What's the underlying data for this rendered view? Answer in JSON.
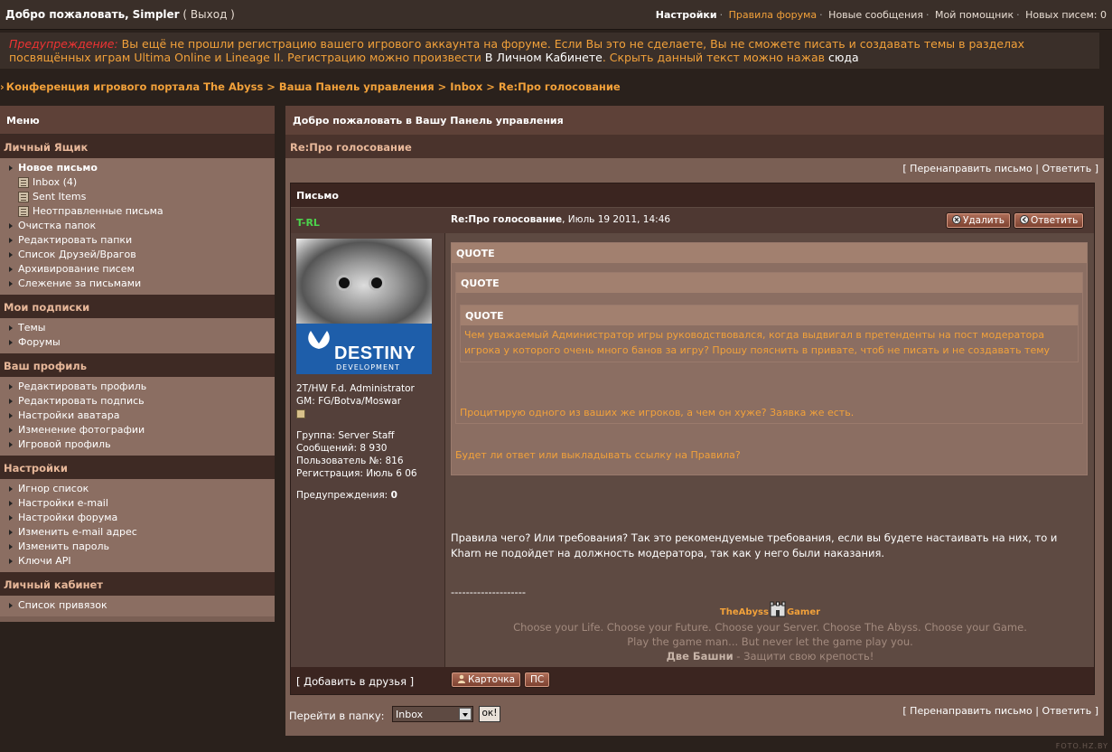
{
  "topbar": {
    "welcome": "Добро пожаловать,",
    "username": "Simpler",
    "logout": "( Выход )",
    "settings": "Настройки",
    "rules": "Правила форума",
    "new_messages": "Новые сообщения",
    "assistant": "Мой помощник",
    "new_letters": "Новых писем: 0"
  },
  "warning": {
    "label": "Предупреждение:",
    "text1": "Вы ещё не прошли регистрацию вашего игрового аккаунта на форуме. Если Вы это не сделаете, Вы не сможете писать и создавать темы в разделах посвящённых играм Ultima Online и Lineage II. Регистрацию можно произвести",
    "cabinet_link": "В Личном Кабинете",
    "text2": ". Скрыть данный текст можно нажав",
    "here_link": "сюда"
  },
  "breadcrumb": "Конференция игрового портала The Abyss > Ваша Панель управления > Inbox > Re:Про голосование",
  "sidebar": {
    "title": "Меню",
    "sections": [
      {
        "title": "Личный Ящик",
        "items": [
          {
            "label": "Новое письмо",
            "bold": true
          },
          {
            "label": "Inbox (4)",
            "sub": true
          },
          {
            "label": "Sent Items",
            "sub": true
          },
          {
            "label": "Неотправленные письма",
            "sub": true
          },
          {
            "label": "Очистка папок"
          },
          {
            "label": "Редактировать папки"
          },
          {
            "label": "Список Друзей/Врагов"
          },
          {
            "label": "Архивирование писем"
          },
          {
            "label": "Слежение за письмами"
          }
        ]
      },
      {
        "title": "Мои подписки",
        "items": [
          {
            "label": "Темы"
          },
          {
            "label": "Форумы"
          }
        ]
      },
      {
        "title": "Ваш профиль",
        "items": [
          {
            "label": "Редактировать профиль"
          },
          {
            "label": "Редактировать подпись"
          },
          {
            "label": "Настройки аватара"
          },
          {
            "label": "Изменение фотографии"
          },
          {
            "label": "Игровой профиль"
          }
        ]
      },
      {
        "title": "Настройки",
        "items": [
          {
            "label": "Игнор список"
          },
          {
            "label": "Настройки e-mail"
          },
          {
            "label": "Настройки форума"
          },
          {
            "label": "Изменить e-mail адрес"
          },
          {
            "label": "Изменить пароль"
          },
          {
            "label": "Ключи API"
          }
        ]
      },
      {
        "title": "Личный кабинет",
        "items": [
          {
            "label": "Список привязок"
          }
        ]
      }
    ]
  },
  "main": {
    "header": "Добро пожаловать в Вашу Панель управления",
    "subheader": "Re:Про голосование",
    "forward": "Перенаправить письмо",
    "reply": "Ответить",
    "box_title": "Письмо",
    "author": "T-RL",
    "subject": "Re:Про голосование",
    "date": ", Июль 19 2011, 14:46",
    "delete_btn": "Удалить",
    "reply_btn": "Ответить",
    "avatar_logo": "DESTINY",
    "avatar_logo_sub": "DEVELOPMENT",
    "user_title1": "2T/HW F.d. Administrator",
    "user_title2": "GM: FG/Botva/Moswar",
    "group": "Группа: Server Staff",
    "posts": "Сообщений: 8 930",
    "user_no": "Пользователь №: 816",
    "registered": "Регистрация: Июль 6 06",
    "warnings_label": "Предупреждения:",
    "warnings_value": "0",
    "quote_label": "QUOTE",
    "quote3": "Чем уважаемый Администратор игры руководствовался, когда выдвигал в претенденты на пост модератора игрока у которого очень много банов за игру? Прошу пояснить в привате, чтоб не писать и не создавать тему",
    "quote2": "Процитирую одного из ваших же игроков, а чем он хуже? Заявка же есть.",
    "quote1": "Будет ли ответ или выкладывать ссылку на Правила?",
    "body": "Правила чего? Или требования? Так это рекомендуемые требования, если вы будете настаивать на них, то и Kharn не подойдет на должность модератора, так как у него были наказания.",
    "divider": "--------------------",
    "sig_brand1": "TheAbyss",
    "sig_brand2": "Gamer",
    "sig_line1": "Choose your Life. Choose your Future. Choose your Server. Choose The Abyss. Choose your Game.",
    "sig_line2": "Play the game man... But never let the game play you.",
    "sig_line3_bold": "Две Башни",
    "sig_line3_rest": " - Защити свою крепость!",
    "add_friend": "[ Добавить в друзья ]",
    "card_btn": "Карточка",
    "pm_btn": "ПС",
    "goto_folder": "Перейти в папку:",
    "folder_value": "Inbox",
    "ok_btn": "ок!"
  },
  "footer_tag": "FOTO.HZ.BY"
}
